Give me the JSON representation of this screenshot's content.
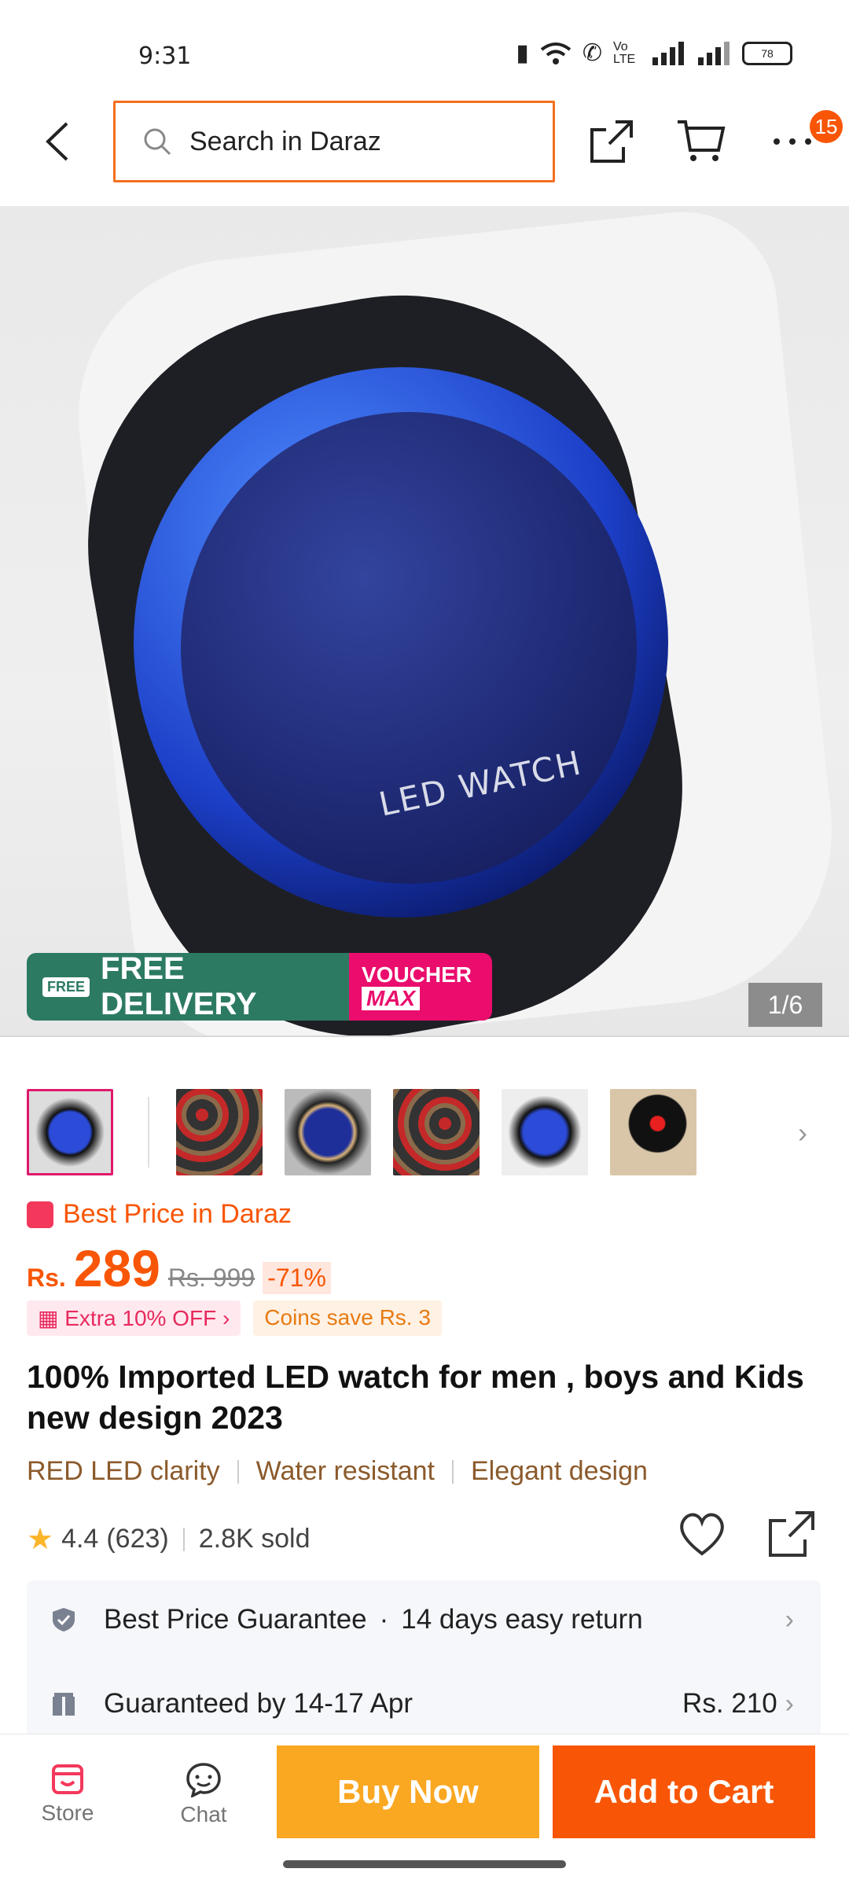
{
  "status_bar": {
    "time": "9:31",
    "battery": "78",
    "network": "Vo LTE"
  },
  "header": {
    "search_placeholder": "Search in Daraz",
    "more_badge": "15"
  },
  "gallery": {
    "watch_text": "LED WATCH",
    "free_delivery_tag": "FREE",
    "free_delivery": "FREE DELIVERY",
    "voucher_line1": "VOUCHER",
    "voucher_line2": "MAX",
    "counter": "1/6",
    "thumbnail_count": 6
  },
  "price": {
    "best_label": "Best Price in Daraz",
    "currency": "Rs.",
    "current": "289",
    "original": "Rs. 999",
    "discount": "-71%",
    "promo_extra": "Extra 10% OFF",
    "promo_coins": "Coins save Rs. 3"
  },
  "product": {
    "title": "100% Imported LED watch for men , boys and Kids new design 2023",
    "features": [
      "RED LED clarity",
      "Water resistant",
      "Elegant design"
    ],
    "rating": "4.4",
    "reviews": "(623)",
    "sold": "2.8K sold"
  },
  "info": {
    "guarantee": "Best Price Guarantee",
    "return": "14 days easy return",
    "delivery": "Guaranteed by 14-17 Apr",
    "shipping_fee": "Rs. 210"
  },
  "bottom_bar": {
    "store": "Store",
    "chat": "Chat",
    "buy_now": "Buy Now",
    "add_to_cart": "Add to Cart"
  },
  "colors": {
    "accent": "#f85606",
    "buy_now": "#faa722",
    "delivery_green": "#2d7a63",
    "voucher_pink": "#ea0d6d"
  }
}
